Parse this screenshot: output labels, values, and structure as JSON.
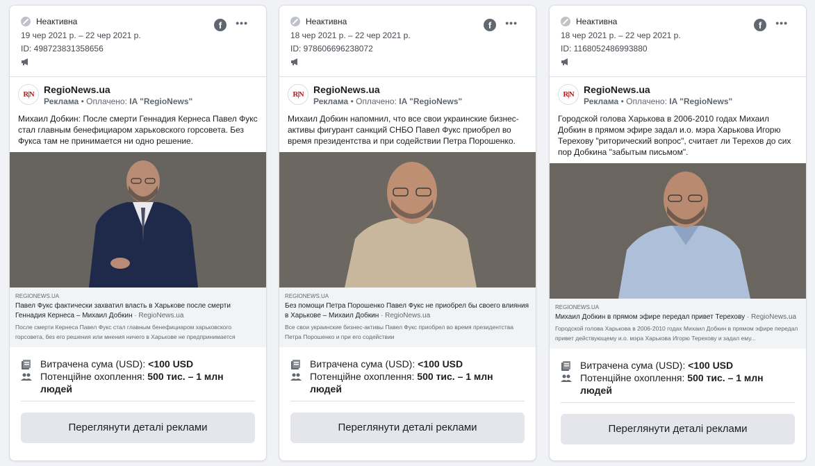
{
  "cards": [
    {
      "status": "Неактивна",
      "dates": "19 чер 2021 р. – 22 чер 2021 р.",
      "id_label": "ID: 498723831358656",
      "page_name": "RegioNews.ua",
      "sponsor_prefix": "Реклама",
      "sponsor_paid": " • Оплачено: ",
      "sponsor_by": "IA \"RegioNews\"",
      "logo_text": "R|N",
      "body": "Михаил Добкин: После смерти Геннадия Кернеса Павел Фукс стал главным бенефициаром харьковского горсовета. Без Фукса там не принимается ни одно решение.",
      "link_domain": "REGIONEWS.UA",
      "link_title": "Павел Фукс фактически захватил власть в Харькове после смерти Геннадия Кернеса – Михаил Добкин",
      "link_title_domain": " · RegioNews.ua",
      "link_desc": "После смерти Кернеса Павел Фукс стал главным бенефициаром харьковского горсовета, без его решения или мнения ничего в Харькове не предпринимается",
      "spend_label": "Витрачена сума (USD): ",
      "spend_value": "<100 USD",
      "reach_label": "Потенційне охоплення: ",
      "reach_value": "500 тис. – 1 млн людей",
      "button": "Переглянути деталі реклами"
    },
    {
      "status": "Неактивна",
      "dates": "18 чер 2021 р. – 22 чер 2021 р.",
      "id_label": "ID: 978606696238072",
      "page_name": "RegioNews.ua",
      "sponsor_prefix": "Реклама",
      "sponsor_paid": " • Оплачено: ",
      "sponsor_by": "IA \"RegioNews\"",
      "logo_text": "R|N",
      "body": "Михаил Добкин напомнил, что все свои украинские бизнес-активы фигурант санкций СНБО Павел Фукс приобрел во время президентства и при содействии Петра Порошенко.",
      "link_domain": "REGIONEWS.UA",
      "link_title": "Без помощи Петра Порошенко Павел Фукс не приобрел бы своего влияния в Харькове – Михаил Добкин",
      "link_title_domain": " · RegioNews.ua",
      "link_desc": "Все свои украинские бизнес-активы Павел Фукс приобрел во время президентства Петра Порошенко и при его содействии",
      "spend_label": "Витрачена сума (USD): ",
      "spend_value": "<100 USD",
      "reach_label": "Потенційне охоплення: ",
      "reach_value": "500 тис. – 1 млн людей",
      "button": "Переглянути деталі реклами"
    },
    {
      "status": "Неактивна",
      "dates": "18 чер 2021 р. – 22 чер 2021 р.",
      "id_label": "ID: 1168052486993880",
      "page_name": "RegioNews.ua",
      "sponsor_prefix": "Реклама",
      "sponsor_paid": " • Оплачено: ",
      "sponsor_by": "IA \"RegioNews\"",
      "logo_text": "R|N",
      "body": "Городской голова Харькова в 2006-2010 годах Михаил Добкин в прямом эфире задал и.о. мэра Харькова Игорю Терехову \"риторический вопрос\", считает ли Терехов до сих пор Добкина \"забытым письмом\".",
      "link_domain": "REGIONEWS.UA",
      "link_title": "Михаил Добкин в прямом эфире передал привет Терехову",
      "link_title_domain": " · RegioNews.ua",
      "link_desc": "Городской голова Харькова в 2006-2010 годах Михаил Добкин в прямом эфире передал привет действующему и.о. мэра Харькова Игорю Терехову и задал ему...",
      "spend_label": "Витрачена сума (USD): ",
      "spend_value": "<100 USD",
      "reach_label": "Потенційне охоплення: ",
      "reach_value": "500 тис. – 1 млн людей",
      "button": "Переглянути деталі реклами"
    }
  ],
  "icons": {
    "status": "inactive-icon",
    "platform": "facebook-icon",
    "menu": "more-options-icon",
    "ad_type": "megaphone-icon",
    "spend": "money-icon",
    "reach": "people-icon"
  },
  "colors": {
    "background": "#f0f2f5",
    "card": "#ffffff",
    "button": "#e4e6eb",
    "muted_text": "#606770",
    "logo_red": "#b01e23"
  }
}
